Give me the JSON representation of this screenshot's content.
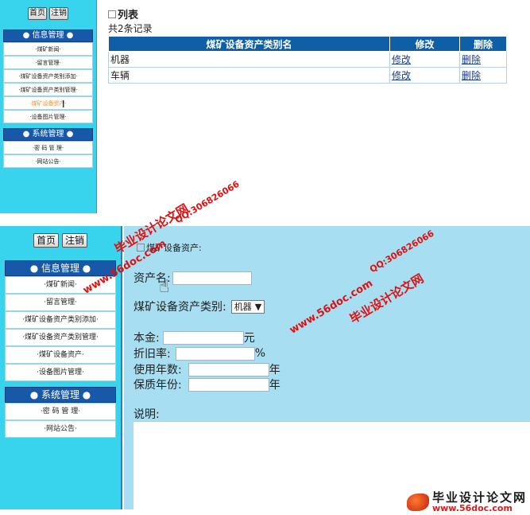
{
  "top_screen": {
    "sidebar": {
      "home_button": "首页",
      "logout_button": "注销",
      "info_header": "● 信息管理 ●",
      "info_items": [
        "·煤矿新闻·",
        "·留言管理·",
        "·煤矿设备资产类别添加·",
        "·煤矿设备资产类别管理·",
        "·煤矿设备资产·",
        "·设备图片管理·"
      ],
      "system_header": "● 系统管理 ●",
      "system_items": [
        "·密 码 管 理·",
        "·网站公告·"
      ]
    },
    "list": {
      "title": "列表",
      "record_count": "共2条记录",
      "columns": [
        "煤矿设备资产类别名",
        "修改",
        "删除"
      ],
      "rows": [
        {
          "name": "机器",
          "edit": "修改",
          "delete": "删除"
        },
        {
          "name": "车辆",
          "edit": "修改",
          "delete": "删除"
        }
      ]
    }
  },
  "bottom_screen": {
    "sidebar": {
      "home_button": "首页",
      "logout_button": "注销",
      "info_header": "● 信息管理 ●",
      "info_items": [
        "·煤矿新闻·",
        "·留言管理·",
        "·煤矿设备资产类别添加·",
        "·煤矿设备资产类别管理·",
        "·煤矿设备资产·",
        "·设备图片管理·"
      ],
      "system_header": "● 系统管理 ●",
      "system_items": [
        "·密 码 管 理·",
        "·网站公告·"
      ]
    },
    "form": {
      "title": "煤矿设备资产:",
      "asset_name_label": "资产名:",
      "category_label": "煤矿设备资产类别:",
      "category_selected": "机器",
      "principal_label": "本金:",
      "principal_unit": "元",
      "depreciation_label": "折旧率:",
      "depreciation_unit": "%",
      "years_label": "使用年数:",
      "years_unit": "年",
      "warranty_label": "保质年份:",
      "warranty_unit": "年",
      "description_label": "说明:"
    }
  },
  "watermarks": {
    "site_name": "毕业设计论文网",
    "qq": "QQ:306826066",
    "url": "www.56doc.com",
    "footer_name": "毕业设计论文网",
    "footer_url": "www.56doc.com"
  }
}
